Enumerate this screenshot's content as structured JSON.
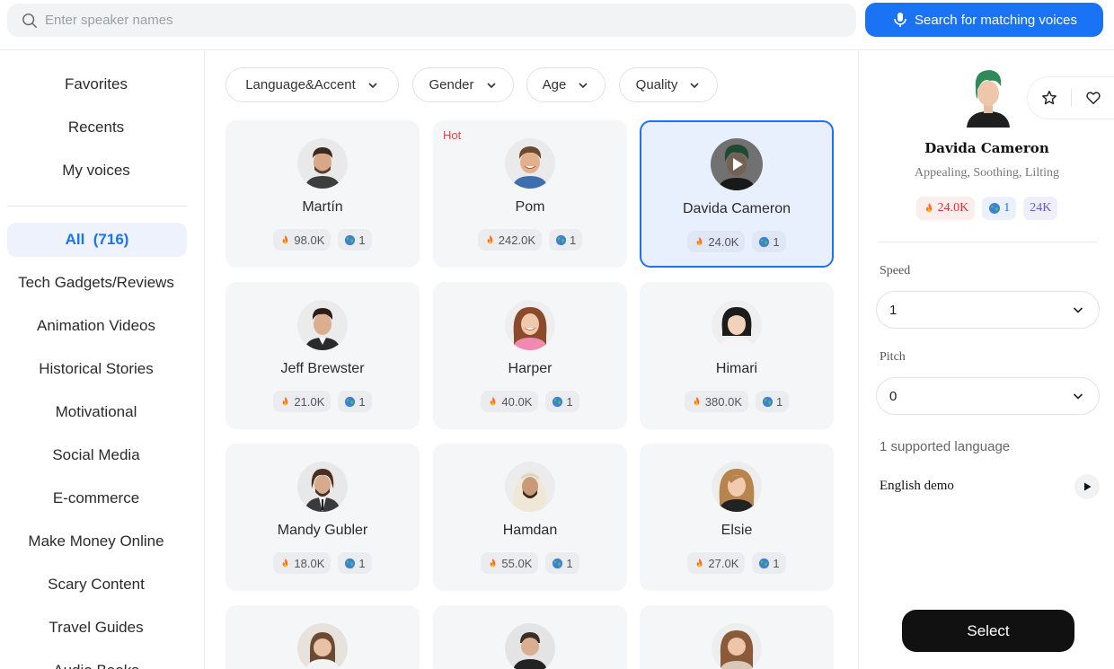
{
  "search": {
    "placeholder": "Enter speaker names",
    "match_button": "Search for matching voices"
  },
  "sidebar": {
    "top_items": [
      "Favorites",
      "Recents",
      "My voices"
    ],
    "all_label": "All",
    "all_count": "(716)",
    "categories": [
      "Tech Gadgets/Reviews",
      "Animation Videos",
      "Historical Stories",
      "Motivational",
      "Social Media",
      "E-commerce",
      "Make Money Online",
      "Scary Content",
      "Travel Guides",
      "Audio Books"
    ]
  },
  "filters": [
    "Language&Accent",
    "Gender",
    "Age",
    "Quality"
  ],
  "voices": [
    {
      "name": "Martín",
      "plays": "98.0K",
      "langs": "1",
      "hot": ""
    },
    {
      "name": "Pom",
      "plays": "242.0K",
      "langs": "1",
      "hot": "Hot"
    },
    {
      "name": "Davida Cameron",
      "plays": "24.0K",
      "langs": "1",
      "hot": ""
    },
    {
      "name": "Jeff Brewster",
      "plays": "21.0K",
      "langs": "1",
      "hot": ""
    },
    {
      "name": "Harper",
      "plays": "40.0K",
      "langs": "1",
      "hot": ""
    },
    {
      "name": "Himari",
      "plays": "380.0K",
      "langs": "1",
      "hot": ""
    },
    {
      "name": "Mandy Gubler",
      "plays": "18.0K",
      "langs": "1",
      "hot": ""
    },
    {
      "name": "Hamdan",
      "plays": "55.0K",
      "langs": "1",
      "hot": ""
    },
    {
      "name": "Elsie",
      "plays": "27.0K",
      "langs": "1",
      "hot": ""
    }
  ],
  "selected": {
    "name": "Davida Cameron",
    "tags": "Appealing, Soothing, Lilting",
    "plays": "24.0K",
    "langs": "1",
    "rate": "24K",
    "speed_label": "Speed",
    "speed_value": "1",
    "pitch_label": "Pitch",
    "pitch_value": "0",
    "lang_count": "1 supported language",
    "demo_label": "English demo",
    "select_button": "Select"
  },
  "colors": {
    "accent": "#1a73f5",
    "hot": "#e64545",
    "select_button": "#111111"
  }
}
